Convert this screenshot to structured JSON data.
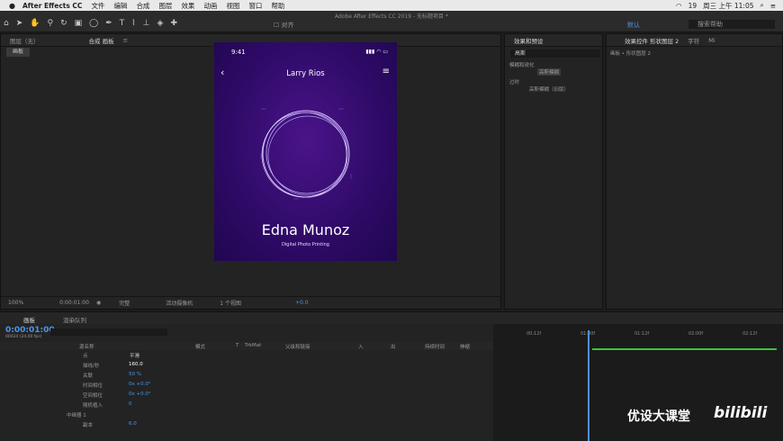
{
  "menubar": {
    "app": "After Effects CC",
    "items": [
      "文件",
      "编辑",
      "合成",
      "图层",
      "效果",
      "动画",
      "视图",
      "窗口",
      "帮助"
    ],
    "battery": "19",
    "time": "周三 上午 11:05"
  },
  "toolbar": {
    "title": "Adobe After Effects CC 2019 - 无标题项目 *",
    "align": "对齐",
    "workspace": "默认",
    "search": "搜索帮助"
  },
  "comp_panel": {
    "tab_layer": "图层（无）",
    "tab_comp": "合成 画板",
    "sub_tab": "画板",
    "zoom": "100%",
    "timecode": "0:00:01:00",
    "quality": "完整",
    "camera": "活动摄像机",
    "views": "1 个视图",
    "exposure": "+0.0"
  },
  "phone": {
    "time": "9:41",
    "header_name": "Larry Rios",
    "name": "Edna Munoz",
    "subtitle": "Digital Photo Printing"
  },
  "fx_panel": {
    "title": "效果和预设",
    "search": "高斯",
    "cat1": "模糊和锐化",
    "item1": "高斯模糊",
    "cat2": "过时",
    "item2": "高斯模糊（旧版）"
  },
  "ctrl_panel": {
    "tab": "效果控件 形状图层 2",
    "tab2": "字符",
    "tab3": "Mi",
    "breadcrumb": "画板 • 形状图层 2"
  },
  "timeline": {
    "tab": "画板",
    "tab2": "渲染队列",
    "timecode": "0:00:01:00",
    "fps": "00024 (24.00 fps)",
    "columns": [
      "源名称",
      "模式",
      "T",
      "TrkMat",
      "父级和链接",
      "入",
      "出",
      "持续时间",
      "伸缩"
    ],
    "rows": [
      {
        "label": "点",
        "value": "平滑"
      },
      {
        "label": "描线/秒",
        "value": "160.0"
      },
      {
        "label": "关联",
        "value": "50 %"
      },
      {
        "label": "时间相位",
        "value": "0x +0.0°"
      },
      {
        "label": "空间相位",
        "value": "0x +0.0°"
      },
      {
        "label": "随机植入",
        "value": "0"
      },
      {
        "label": "中继器 1",
        "value": ""
      },
      {
        "label": "副本",
        "value": "6.0"
      }
    ],
    "ruler": [
      "00:12f",
      "01:00f",
      "01:12f",
      "02:00f",
      "02:12f"
    ]
  },
  "watermark": {
    "text": "优设大课堂",
    "logo": "bilibili"
  }
}
